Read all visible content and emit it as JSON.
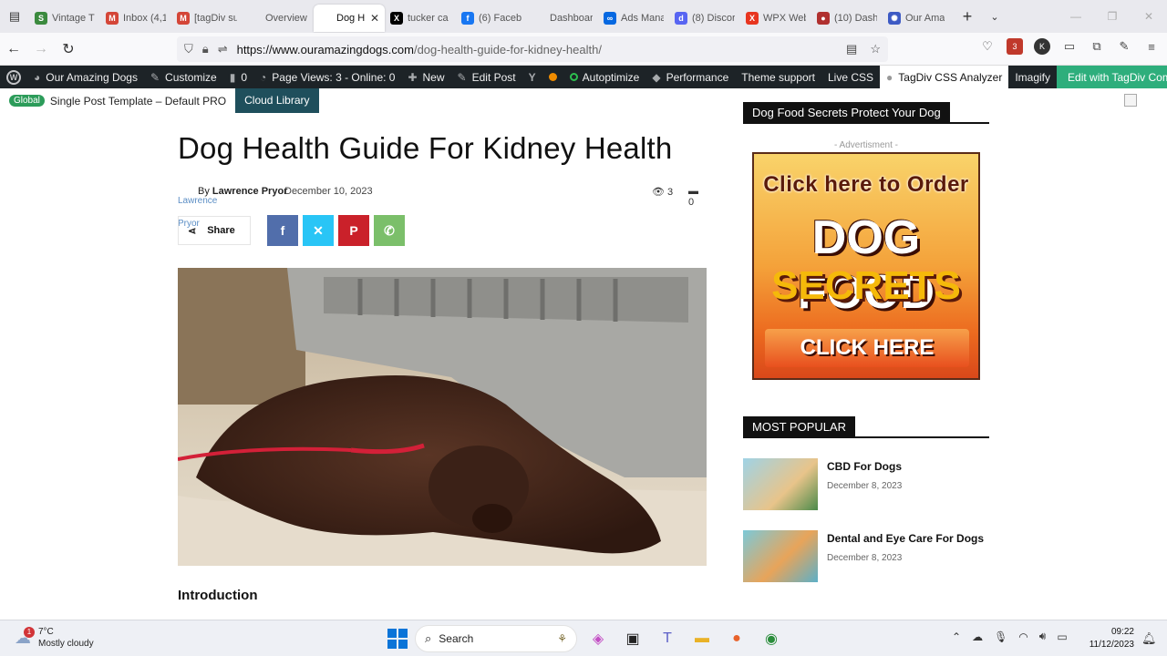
{
  "browser": {
    "tabs": [
      {
        "label": "Vintage T",
        "color": "#3b8a3e",
        "glyph": "S"
      },
      {
        "label": "Inbox (4,1",
        "color": "#d44638",
        "glyph": "M"
      },
      {
        "label": "[tagDiv su",
        "color": "#d44638",
        "glyph": "M"
      },
      {
        "label": "Overview ‹ O",
        "color": "#e9e9ee",
        "glyph": ""
      },
      {
        "label": "Dog Healtl",
        "color": "#fff",
        "glyph": "",
        "active": true
      },
      {
        "label": "tucker ca",
        "color": "#000",
        "glyph": "X"
      },
      {
        "label": "(6) Faceb",
        "color": "#1877f2",
        "glyph": "f"
      },
      {
        "label": "Dashboard -",
        "color": "#e9e9ee",
        "glyph": ""
      },
      {
        "label": "Ads Mana",
        "color": "#0668e1",
        "glyph": "∞"
      },
      {
        "label": "(8) Discor",
        "color": "#5865f2",
        "glyph": "d"
      },
      {
        "label": "WPX Web",
        "color": "#e8351f",
        "glyph": "X"
      },
      {
        "label": "(10) Dash",
        "color": "#b0302f",
        "glyph": "●"
      },
      {
        "label": "Our Ama",
        "color": "#3d5ac4",
        "glyph": "✺"
      }
    ],
    "url_host": "https://www.ouramazingdogs.com",
    "url_path": "/dog-health-guide-for-kidney-health/"
  },
  "adminbar": {
    "site_name": "Our Amazing Dogs",
    "customize": "Customize",
    "comments": "0",
    "page_views": "Page Views: 3 - Online: 0",
    "new": "New",
    "edit_post": "Edit Post",
    "autoptimize": "Autoptimize",
    "performance": "Performance",
    "theme_support": "Theme support",
    "live_css": "Live CSS",
    "css_analyzer": "TagDiv CSS Analyzer",
    "imagify": "Imagify",
    "composer": "Edit with TagDiv Composer"
  },
  "template_bar": {
    "badge": "Global",
    "template": "Single Post Template – Default PRO",
    "cloud": "Cloud Library"
  },
  "article": {
    "title": "Dog Health Guide For Kidney Health",
    "author_ghost": "Lawrence Pryor",
    "by": "By",
    "author": "Lawrence Pryor",
    "date": "December 10, 2023",
    "views": "3",
    "comments": "0",
    "share": "Share",
    "intro_heading": "Introduction"
  },
  "sidebar": {
    "ad_heading": "Dog Food Secrets Protect Your Dog",
    "advertisement": "- Advertisment -",
    "ad_line1": "Click here to Order",
    "ad_line2": "DOG FOOD",
    "ad_line3": "SECRETS",
    "ad_button": "CLICK HERE",
    "popular_heading": "MOST POPULAR",
    "popular": [
      {
        "title": "CBD For Dogs",
        "date": "December 8, 2023"
      },
      {
        "title": "Dental and Eye Care For Dogs",
        "date": "December 8, 2023"
      }
    ]
  },
  "taskbar": {
    "temp": "7°C",
    "weather": "Mostly cloudy",
    "weather_badge": "1",
    "search": "Search",
    "time": "09:22",
    "date": "11/12/2023"
  }
}
